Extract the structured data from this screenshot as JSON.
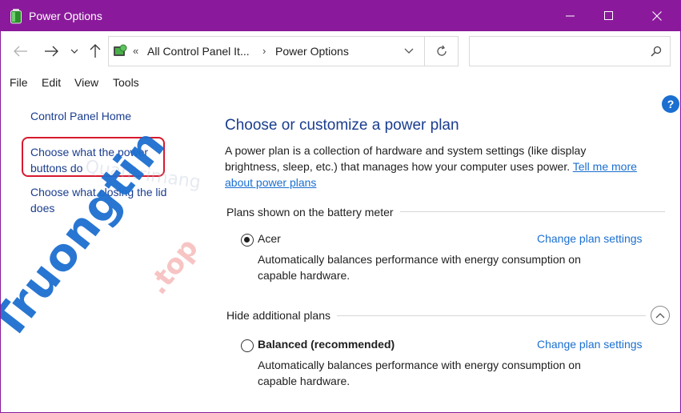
{
  "window": {
    "title": "Power Options",
    "accent_color": "#8a1a9b"
  },
  "nav": {
    "back_icon": "arrow-left-icon",
    "forward_icon": "arrow-right-icon",
    "recent_icon": "chevron-down-icon",
    "up_icon": "arrow-up-icon"
  },
  "address": {
    "overflow": "«",
    "crumbs": [
      "All Control Panel It...",
      "Power Options"
    ],
    "separator": "›"
  },
  "search": {
    "placeholder": ""
  },
  "menu": [
    "File",
    "Edit",
    "View",
    "Tools"
  ],
  "left_pane": {
    "home_link": "Control Panel Home",
    "power_buttons_line1": "Choose what the power",
    "power_buttons_line2": "buttons do",
    "closing_lid_line1": "Choose what closing the lid",
    "closing_lid_line2": "does"
  },
  "help": "?",
  "main": {
    "title": "Choose or customize a power plan",
    "description_line1": "A power plan is a collection of hardware and system settings (like display",
    "description_line2_text": "brightness, sleep, etc.) that manages how your computer uses power.",
    "description_link_part1": "Tell me more",
    "description_link_part2": "about power plans",
    "battery_section_label": "Plans shown on the battery meter",
    "hide_section_label": "Hide additional plans",
    "plans": [
      {
        "name": "Acer",
        "selected": true,
        "change_link": "Change plan settings",
        "desc_line1": "Automatically balances performance with energy consumption on",
        "desc_line2": "capable hardware."
      },
      {
        "name": "Balanced (recommended)",
        "selected": false,
        "change_link": "Change plan settings",
        "desc_line1": "Automatically balances performance with energy consumption on",
        "desc_line2": "capable hardware."
      }
    ]
  },
  "watermark": {
    "main": "Truongtin",
    "tld": ".top",
    "faint": "Quantrimang"
  }
}
